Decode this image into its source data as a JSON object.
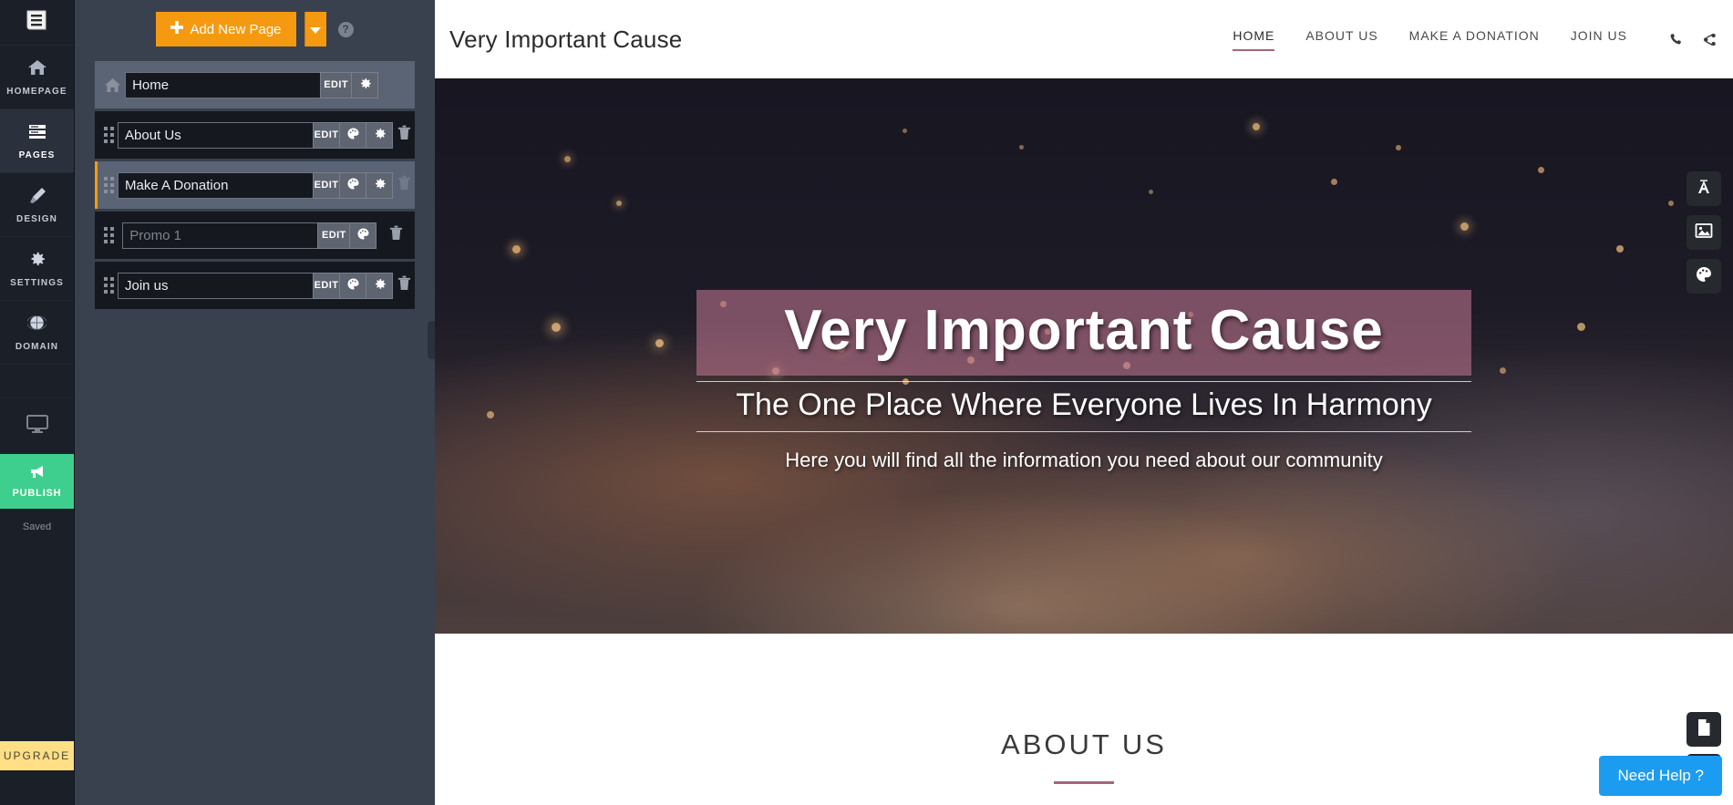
{
  "rail": {
    "logo_icon": "menu-document-icon",
    "items": [
      {
        "label": "HOMEPAGE",
        "icon": "home-icon",
        "active": false
      },
      {
        "label": "PAGES",
        "icon": "pages-icon",
        "active": true
      },
      {
        "label": "DESIGN",
        "icon": "brush-icon",
        "active": false
      },
      {
        "label": "SETTINGS",
        "icon": "gear-icon",
        "active": false
      },
      {
        "label": "DOMAIN",
        "icon": "globe-icon",
        "active": false
      }
    ],
    "preview_icon": "monitor-icon",
    "publish_label": "PUBLISH",
    "publish_icon": "megaphone-icon",
    "saved_label": "Saved",
    "upgrade_label": "UPGRADE",
    "publish_color": "#3ecf8e",
    "upgrade_color": "#ffdf85"
  },
  "panel": {
    "add_page_label": "Add New Page",
    "add_page_color": "#f59a10",
    "add_page_caret_icon": "chevron-down-icon",
    "help_icon": "question-mark-icon",
    "edit_label": "EDIT",
    "pages": [
      {
        "name": "Home",
        "placeholder": "",
        "is_home": true,
        "selected": true,
        "editing": false,
        "buttons": [
          "EDIT",
          "gear"
        ],
        "has_trash": false
      },
      {
        "name": "About Us",
        "placeholder": "",
        "is_home": false,
        "selected": false,
        "editing": false,
        "buttons": [
          "EDIT",
          "palette",
          "gear"
        ],
        "has_trash": true
      },
      {
        "name": "Make A Donation",
        "placeholder": "",
        "is_home": false,
        "selected": false,
        "editing": true,
        "buttons": [
          "EDIT",
          "palette",
          "gear"
        ],
        "has_trash": true
      },
      {
        "name": "",
        "placeholder": "Promo 1",
        "is_home": false,
        "selected": false,
        "editing": false,
        "buttons": [
          "EDIT",
          "palette"
        ],
        "has_trash": true
      },
      {
        "name": "Join us",
        "placeholder": "",
        "is_home": false,
        "selected": false,
        "editing": false,
        "buttons": [
          "EDIT",
          "palette",
          "gear"
        ],
        "has_trash": true
      }
    ]
  },
  "site": {
    "logo": "Very Important Cause",
    "nav": [
      {
        "label": "HOME",
        "active": true
      },
      {
        "label": "ABOUT US",
        "active": false
      },
      {
        "label": "MAKE A DONATION",
        "active": false
      },
      {
        "label": "JOIN US",
        "active": false
      }
    ],
    "nav_icons": [
      {
        "name": "phone-icon"
      },
      {
        "name": "share-icon"
      }
    ],
    "accent_color": "#a3677c",
    "hero": {
      "title": "Very Important Cause",
      "subtitle": "The One Place Where Everyone Lives In Harmony",
      "description": "Here you will find all the information you need about our community",
      "band_color": "rgba(183, 113, 139, .62)"
    },
    "about": {
      "title": "ABOUT US"
    }
  },
  "overlay": {
    "tools": [
      {
        "icon": "text-tool-icon",
        "glyph": "A"
      },
      {
        "icon": "image-tool-icon",
        "glyph": ""
      },
      {
        "icon": "palette-tool-icon",
        "glyph": ""
      }
    ],
    "bottom_tools": [
      {
        "icon": "page-tool-icon"
      },
      {
        "icon": "palette-tool-icon"
      }
    ],
    "need_help_label": "Need Help ?",
    "need_help_color": "#1c9cf0"
  }
}
